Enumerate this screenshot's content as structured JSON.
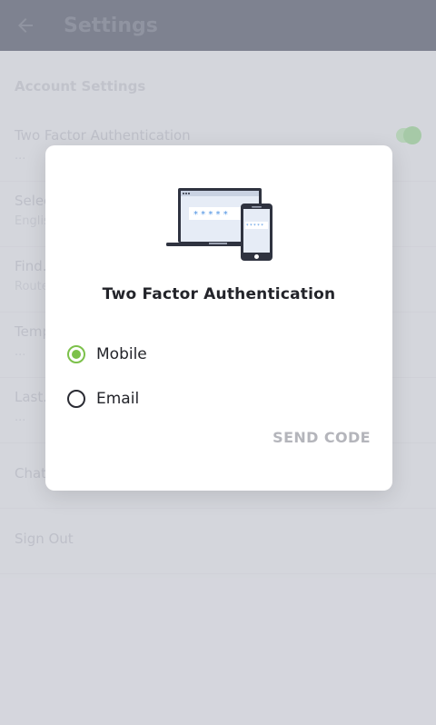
{
  "appbar": {
    "title": "Settings",
    "back_icon": "arrow-left-icon"
  },
  "background": {
    "section_title": "Account Settings",
    "rows": [
      {
        "title": "Two Factor Authentication",
        "subtitle": "..."
      },
      {
        "title": "Select...",
        "subtitle": "English"
      },
      {
        "title": "Find...",
        "subtitle": "Route..."
      },
      {
        "title": "Temp...",
        "subtitle": "..."
      },
      {
        "title": "Last...",
        "subtitle": "..."
      },
      {
        "title": "Chat...",
        "subtitle": ""
      },
      {
        "title": "Sign Out",
        "subtitle": ""
      }
    ],
    "toggle_on": true
  },
  "dialog": {
    "title": "Two Factor Authentication",
    "illustration_icon": "laptop-phone-password-icon",
    "options": [
      {
        "label": "Mobile",
        "selected": true
      },
      {
        "label": "Email",
        "selected": false
      }
    ],
    "send_label": "SEND CODE",
    "accent_color": "#7cc14a"
  }
}
